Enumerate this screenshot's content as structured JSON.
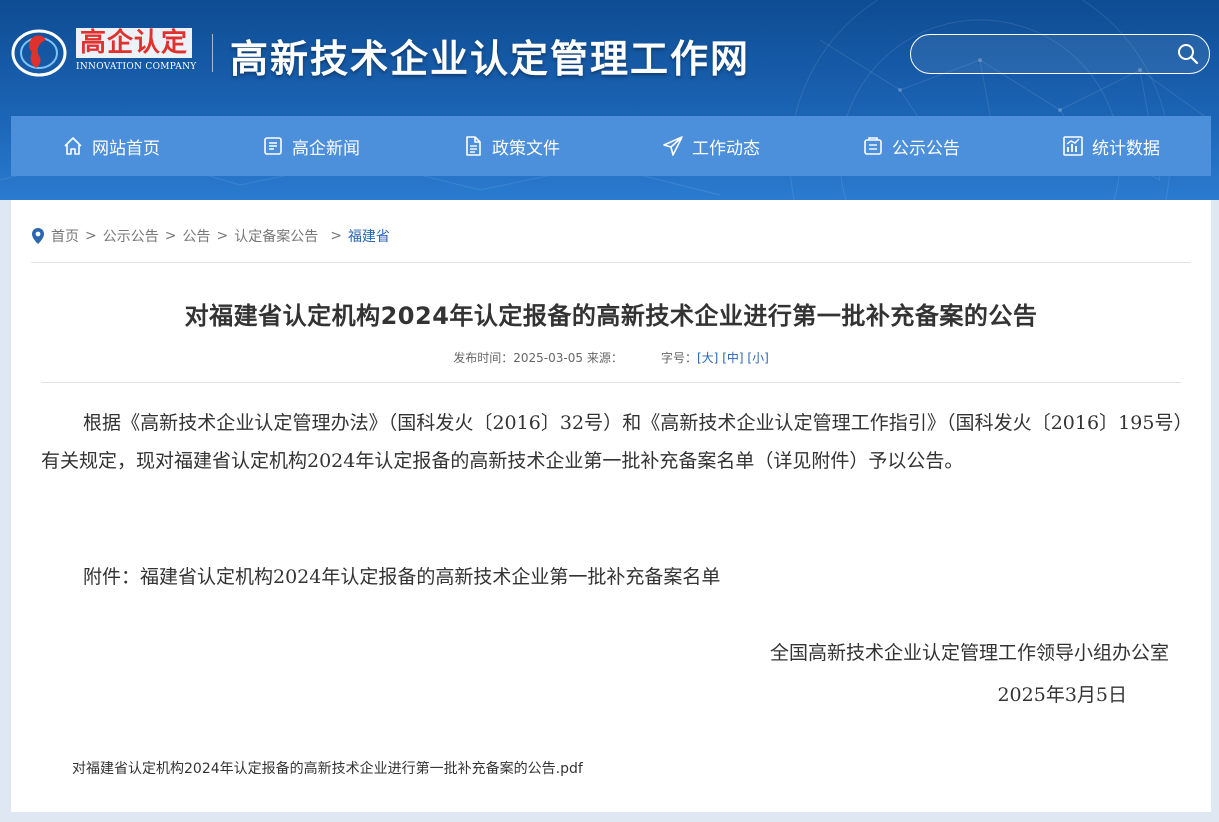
{
  "header": {
    "logo_cn": "高企认定",
    "logo_en": "INNOVATION COMPANY",
    "site_title": "高新技术企业认定管理工作网",
    "search_placeholder": ""
  },
  "nav": {
    "items": [
      {
        "label": "网站首页",
        "icon": "home-icon"
      },
      {
        "label": "高企新闻",
        "icon": "news-icon"
      },
      {
        "label": "政策文件",
        "icon": "document-icon"
      },
      {
        "label": "工作动态",
        "icon": "send-icon"
      },
      {
        "label": "公示公告",
        "icon": "notice-icon"
      },
      {
        "label": "统计数据",
        "icon": "chart-icon"
      }
    ]
  },
  "breadcrumb": {
    "items": [
      "首页",
      "公示公告",
      "公告",
      "认定备案公告",
      "福建省"
    ]
  },
  "article": {
    "title": "对福建省认定机构2024年认定报备的高新技术企业进行第一批补充备案的公告",
    "publish_label": "发布时间：",
    "publish_date": "2025-03-05",
    "source_label": "来源：",
    "font_size_label": "字号：",
    "font_large": "[大]",
    "font_medium": "[中]",
    "font_small": "[小]",
    "body": "根据《高新技术企业认定管理办法》（国科发火〔2016〕32号）和《高新技术企业认定管理工作指引》（国科发火〔2016〕195号）有关规定，现对福建省认定机构2024年认定报备的高新技术企业第一批补充备案名单（详见附件）予以公告。",
    "attachment_line": "附件：福建省认定机构2024年认定报备的高新技术企业第一批补充备案名单",
    "signature_org": "全国高新技术企业认定管理工作领导小组办公室",
    "signature_date": "2025年3月5日",
    "pdf_link": "对福建省认定机构2024年认定报备的高新技术企业进行第一批补充备案的公告.pdf"
  },
  "colors": {
    "header_bg": "#1b63b3",
    "nav_bg": "#4c8fdb",
    "link": "#2b66b1",
    "logo_red": "#e0312d"
  }
}
